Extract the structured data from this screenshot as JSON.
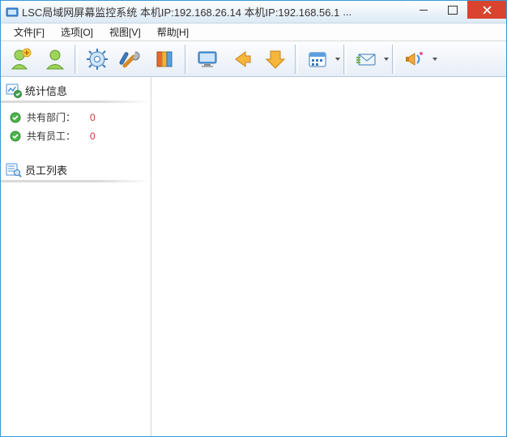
{
  "title": "LSC局域网屏幕监控系统    本机IP:192.168.26.14  本机IP:192.168.56.1",
  "title_ellipsis": "...",
  "menu": {
    "file": "文件[F]",
    "options": "选项[O]",
    "view": "视图[V]",
    "help": "帮助[H]"
  },
  "sidebar": {
    "stats_header": "统计信息",
    "employees_header": "员工列表",
    "rows": [
      {
        "label": "共有部门：",
        "value": "0"
      },
      {
        "label": "共有员工：",
        "value": "0"
      }
    ]
  },
  "toolbar": {
    "user_add": "add-user",
    "user_green": "user",
    "gear": "settings",
    "tools": "tools",
    "books": "library",
    "monitor": "monitor",
    "arrow_left": "back",
    "arrow_down": "down",
    "calendar": "calendar",
    "mail": "mail",
    "speaker": "announce"
  }
}
